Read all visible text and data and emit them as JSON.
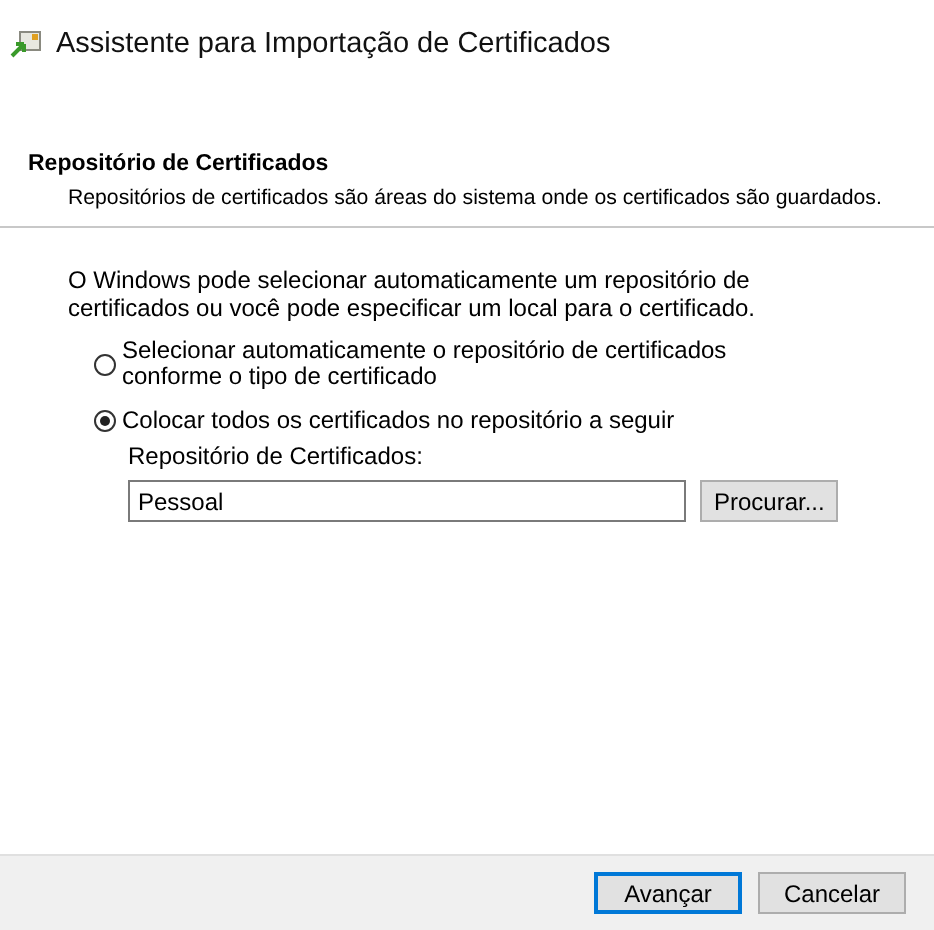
{
  "window": {
    "title": "Assistente para Importação de Certificados"
  },
  "header": {
    "title": "Repositório de Certificados",
    "description": "Repositórios de certificados são áreas do sistema onde os certificados são guardados."
  },
  "intro": "O Windows pode selecionar automaticamente um repositório de certificados ou você pode especificar um local para o certificado.",
  "options": [
    {
      "label": "Selecionar automaticamente o repositório de certificados conforme o tipo de certificado",
      "selected": false
    },
    {
      "label": "Colocar todos os certificados no repositório a seguir",
      "selected": true
    }
  ],
  "store": {
    "label": "Repositório de Certificados:",
    "value": "Pessoal",
    "browse": "Procurar..."
  },
  "buttons": [
    {
      "label": "Avançar",
      "default": true
    },
    {
      "label": "Cancelar",
      "default": false
    }
  ]
}
